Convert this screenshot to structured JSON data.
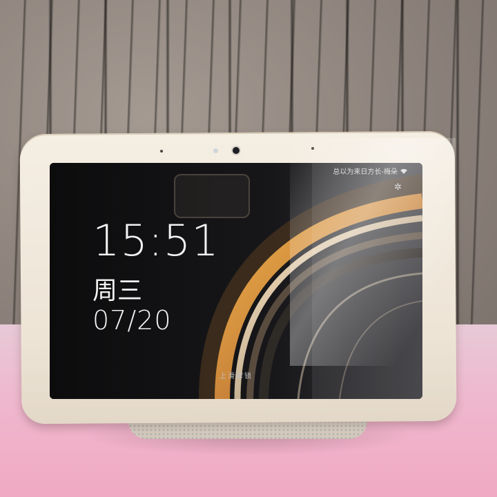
{
  "lockscreen": {
    "time": "15:51",
    "weekday": "周三",
    "date": "07/20",
    "notification": "总以为来日方长-梅朵",
    "unlock_hint": "上滑解锁"
  },
  "icons": {
    "wifi": "wifi-icon",
    "settings": "gear-icon",
    "camera": "camera-icon"
  },
  "colors": {
    "bezel": "#f0e8dc",
    "screen": "#0c0c0d",
    "cloth": "#efb7cd",
    "curtain": "#8c827b"
  }
}
